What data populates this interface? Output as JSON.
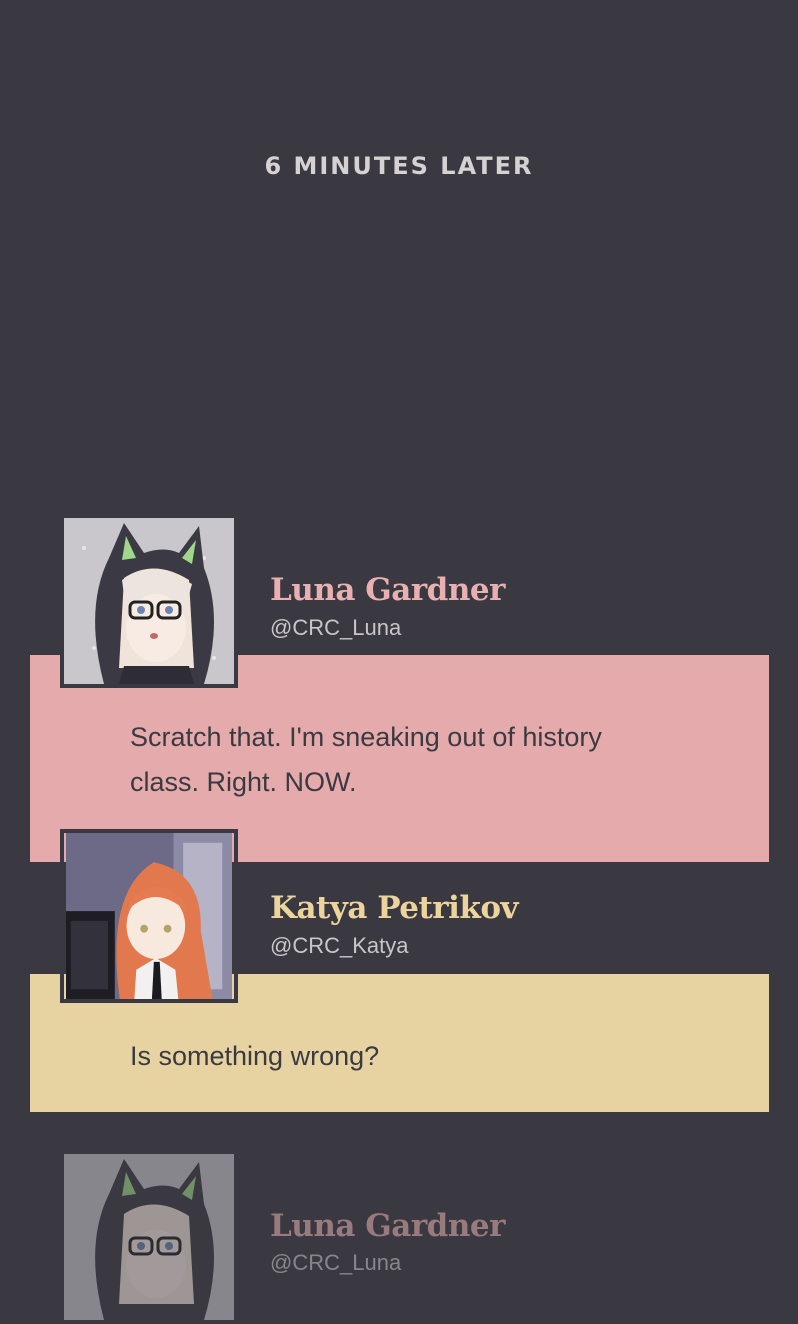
{
  "time_caption": "6 MINUTES LATER",
  "colors": {
    "background": "#3a3840",
    "luna_bubble": "#e4aaac",
    "katya_bubble": "#e6d3a1",
    "luna_name": "#e8b0b0",
    "katya_name": "#ecd49c",
    "handle": "#c9c5c8"
  },
  "messages": [
    {
      "avatar_icon": "luna-avatar-icon",
      "name": "Luna Gardner",
      "handle": "@CRC_Luna",
      "text_lines": [
        "Scratch that. I'm sneaking out of history",
        "class. Right. NOW."
      ]
    },
    {
      "avatar_icon": "katya-avatar-icon",
      "name": "Katya Petrikov",
      "handle": "@CRC_Katya",
      "text_lines": [
        "Is something wrong?"
      ]
    },
    {
      "avatar_icon": "luna-avatar-icon",
      "name": "Luna Gardner",
      "handle": "@CRC_Luna",
      "text_lines": []
    }
  ]
}
